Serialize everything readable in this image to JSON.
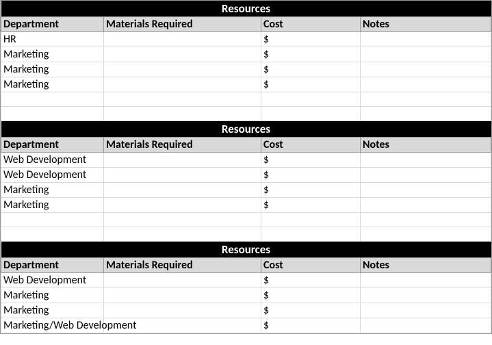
{
  "sections": [
    {
      "title": "Resources",
      "columns": [
        "Department",
        "Materials Required",
        "Cost",
        "Notes"
      ],
      "rows": [
        {
          "department": "HR",
          "materials": "",
          "cost": "$",
          "notes": ""
        },
        {
          "department": "Marketing",
          "materials": "",
          "cost": "$",
          "notes": ""
        },
        {
          "department": "Marketing",
          "materials": "",
          "cost": "$",
          "notes": ""
        },
        {
          "department": "Marketing",
          "materials": "",
          "cost": "$",
          "notes": ""
        }
      ],
      "blank_rows": 2
    },
    {
      "title": "Resources",
      "columns": [
        "Department",
        "Materials Required",
        "Cost",
        "Notes"
      ],
      "rows": [
        {
          "department": "Web Development",
          "materials": "",
          "cost": "$",
          "notes": ""
        },
        {
          "department": "Web Development",
          "materials": "",
          "cost": "$",
          "notes": ""
        },
        {
          "department": "Marketing",
          "materials": "",
          "cost": "$",
          "notes": ""
        },
        {
          "department": "Marketing",
          "materials": "",
          "cost": "$",
          "notes": ""
        }
      ],
      "blank_rows": 2
    },
    {
      "title": "Resources",
      "columns": [
        "Department",
        "Materials Required",
        "Cost",
        "Notes"
      ],
      "rows": [
        {
          "department": "Web Development",
          "materials": "",
          "cost": "$",
          "notes": ""
        },
        {
          "department": "Marketing",
          "materials": "",
          "cost": "$",
          "notes": ""
        },
        {
          "department": "Marketing",
          "materials": "",
          "cost": "$",
          "notes": ""
        },
        {
          "department": "Marketing/Web Development",
          "materials": "",
          "cost": "$",
          "notes": ""
        }
      ],
      "blank_rows": 0
    }
  ]
}
